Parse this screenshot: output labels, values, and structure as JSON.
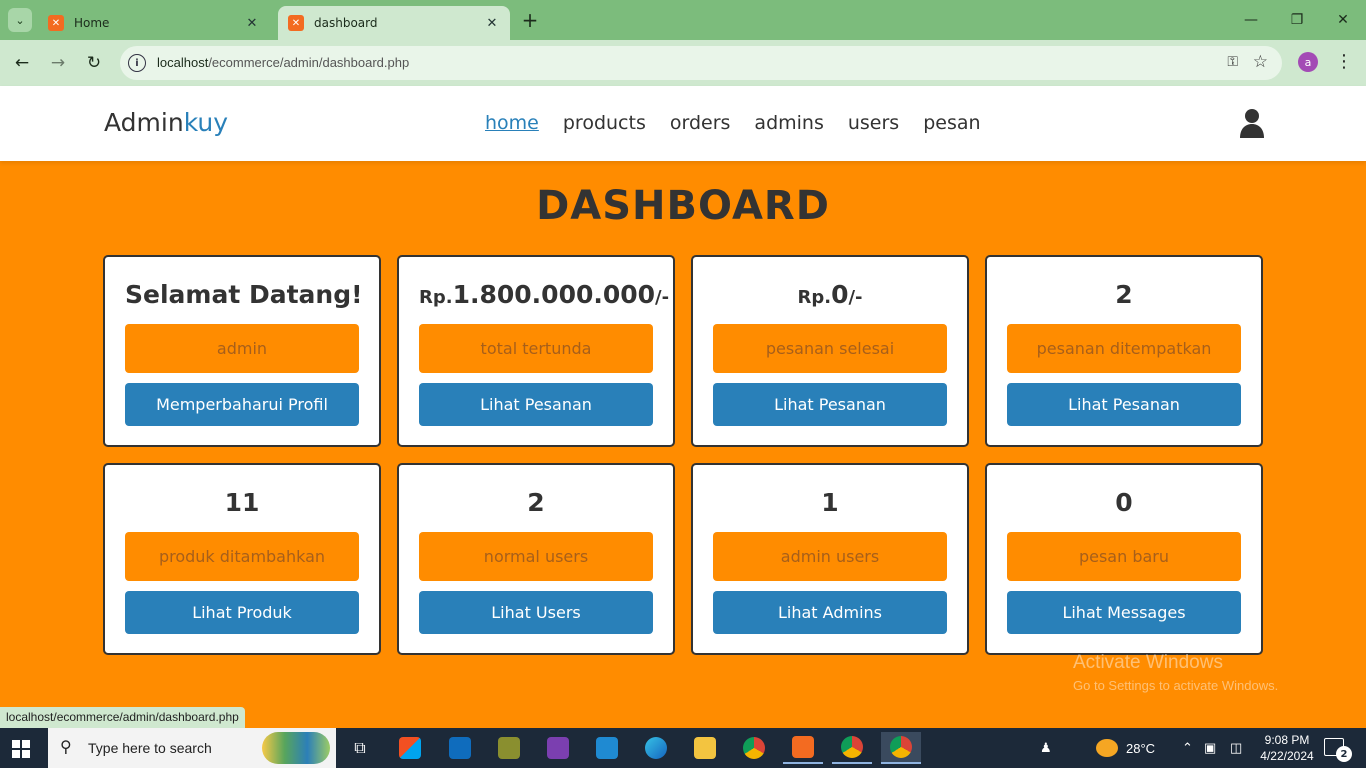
{
  "browser": {
    "tabs": [
      {
        "title": "Home",
        "active": false
      },
      {
        "title": "dashboard",
        "active": true
      }
    ],
    "url_host": "localhost",
    "url_path": "/ecommerce/admin/dashboard.php",
    "profile_initial": "a",
    "status_url": "localhost/ecommerce/admin/dashboard.php"
  },
  "header": {
    "logo_main": "Admin",
    "logo_accent": "kuy",
    "nav": [
      "home",
      "products",
      "orders",
      "admins",
      "users",
      "pesan"
    ],
    "active_nav": "home"
  },
  "dashboard": {
    "title": "DASHBOARD",
    "cards": [
      {
        "heading": "Selamat Datang!",
        "label": "admin",
        "button": "Memperbaharui Profil"
      },
      {
        "prefix": "Rp.",
        "heading": "1.800.000.000",
        "suffix": "/-",
        "label": "total tertunda",
        "button": "Lihat Pesanan"
      },
      {
        "prefix": "Rp.",
        "heading": "0",
        "suffix": "/-",
        "label": "pesanan selesai",
        "button": "Lihat Pesanan"
      },
      {
        "heading": "2",
        "label": "pesanan ditempatkan",
        "button": "Lihat Pesanan"
      },
      {
        "heading": "11",
        "label": "produk ditambahkan",
        "button": "Lihat Produk"
      },
      {
        "heading": "2",
        "label": "normal users",
        "button": "Lihat Users"
      },
      {
        "heading": "1",
        "label": "admin users",
        "button": "Lihat Admins"
      },
      {
        "heading": "0",
        "label": "pesan baru",
        "button": "Lihat Messages"
      }
    ]
  },
  "watermark": {
    "line1": "Activate Windows",
    "line2": "Go to Settings to activate Windows."
  },
  "taskbar": {
    "search_placeholder": "Type here to search",
    "weather": "28°C",
    "time": "9:08 PM",
    "date": "4/22/2024",
    "notifications": "2"
  },
  "colors": {
    "page_bg": "#ff8c00",
    "accent_blue": "#2980b9",
    "label_text": "#a75f1a",
    "chrome_green": "#7cbc7c",
    "taskbar": "#1c2939"
  }
}
